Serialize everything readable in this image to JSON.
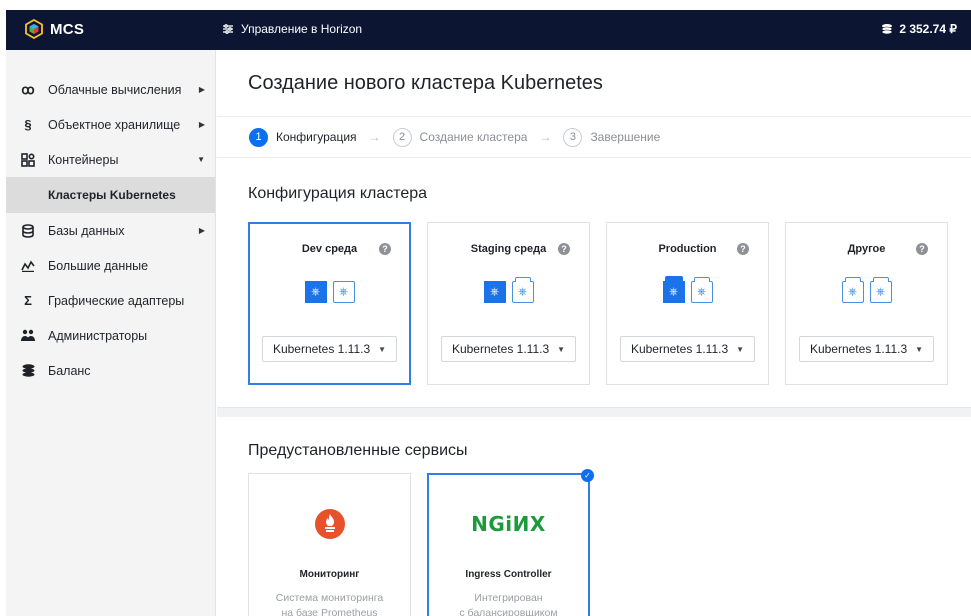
{
  "app": {
    "brand": "MCS",
    "horizon_link": "Управление в Horizon",
    "balance": "2 352.74 ₽"
  },
  "sidebar": {
    "items": [
      {
        "label": "Облачные вычисления",
        "icon": "cloud-compute-icon",
        "has_arrow": true
      },
      {
        "label": "Объектное хранилище",
        "icon": "object-storage-icon",
        "has_arrow": true
      },
      {
        "label": "Контейнеры",
        "icon": "containers-icon",
        "expanded": true
      },
      {
        "label": "Кластеры Kubernetes",
        "sub": true,
        "active": true
      },
      {
        "label": "Базы данных",
        "icon": "database-icon",
        "has_arrow": true
      },
      {
        "label": "Большие данные",
        "icon": "big-data-icon"
      },
      {
        "label": "Графические адаптеры",
        "icon": "sigma-icon"
      },
      {
        "label": "Администраторы",
        "icon": "admins-icon"
      },
      {
        "label": "Баланс",
        "icon": "balance-icon"
      }
    ]
  },
  "main": {
    "title": "Создание нового кластера Kubernetes",
    "steps": [
      {
        "num": "1",
        "label": "Конфигурация",
        "active": true
      },
      {
        "num": "2",
        "label": "Создание кластера"
      },
      {
        "num": "3",
        "label": "Завершение"
      }
    ],
    "config_section_title": "Конфигурация кластера",
    "configs": [
      {
        "name": "Dev среда",
        "version": "Kubernetes 1.11.3",
        "selected": true
      },
      {
        "name": "Staging среда",
        "version": "Kubernetes 1.11.3"
      },
      {
        "name": "Production",
        "version": "Kubernetes 1.11.3"
      },
      {
        "name": "Другое",
        "version": "Kubernetes 1.11.3"
      }
    ],
    "services_section_title": "Предустановленные сервисы",
    "services": [
      {
        "logo": "NGiNX-prometheus",
        "name": "Мониторинг",
        "desc_line1": "Система мониторинга",
        "desc_line2": "на базе Prometheus"
      },
      {
        "logo": "NGiИX",
        "name": "Ingress Controller",
        "desc_line1": "Интегрирован",
        "desc_line2": "с балансировщиком",
        "selected": true
      }
    ]
  },
  "colors": {
    "header_bg": "#0c1633",
    "accent": "#0d6ef0",
    "sidebar_bg": "#f4f4f4",
    "active_item_bg": "#dcdcdc",
    "prometheus": "#e6522c",
    "nginx": "#1d9a3e"
  }
}
